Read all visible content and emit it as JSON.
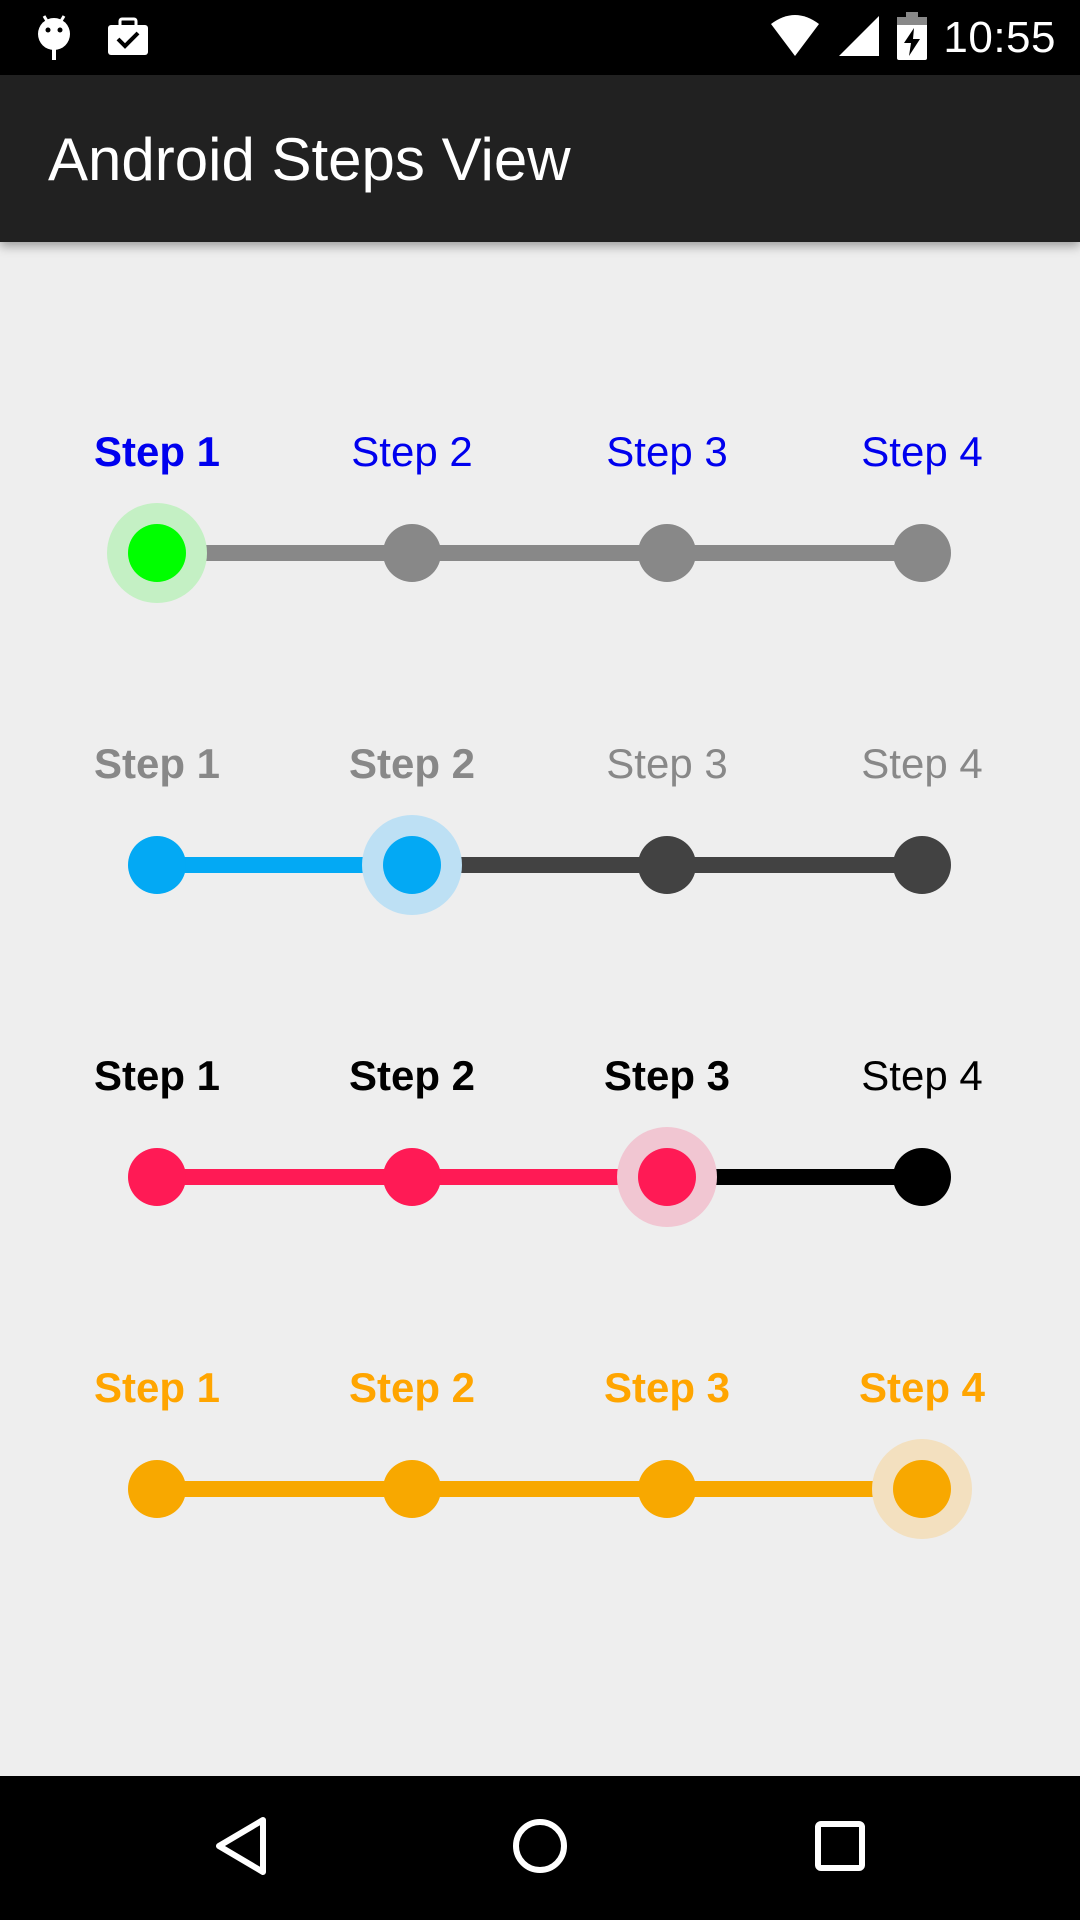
{
  "status_bar": {
    "time": "10:55",
    "icons_left": [
      "android-debug-icon",
      "clipboard-check-icon"
    ],
    "icons_right": [
      "wifi-icon",
      "signal-icon",
      "battery-charging-icon"
    ]
  },
  "app_bar": {
    "title": "Android Steps View"
  },
  "steppers": [
    {
      "labels": [
        "Step 1",
        "Step 2",
        "Step 3",
        "Step 4"
      ],
      "current": 0,
      "label_color": "#0000ee",
      "done_color": "#00ff00",
      "todo_color": "#888888",
      "halo_color": "#c4f0c4"
    },
    {
      "labels": [
        "Step 1",
        "Step 2",
        "Step 3",
        "Step 4"
      ],
      "current": 1,
      "label_color": "#888888",
      "done_color": "#03a9f4",
      "todo_color": "#424242",
      "halo_color": "#bde0f4"
    },
    {
      "labels": [
        "Step 1",
        "Step 2",
        "Step 3",
        "Step 4"
      ],
      "current": 2,
      "label_color": "#000000",
      "done_color": "#ff1a55",
      "todo_color": "#000000",
      "halo_color": "#f1c6d2"
    },
    {
      "labels": [
        "Step 1",
        "Step 2",
        "Step 3",
        "Step 4"
      ],
      "current": 3,
      "label_color": "#ffa500",
      "done_color": "#f8a800",
      "todo_color": "#f8a800",
      "halo_color": "#f3e0bf"
    }
  ],
  "nav_bar": {
    "icons": [
      "back-icon",
      "home-icon",
      "recents-icon"
    ]
  }
}
